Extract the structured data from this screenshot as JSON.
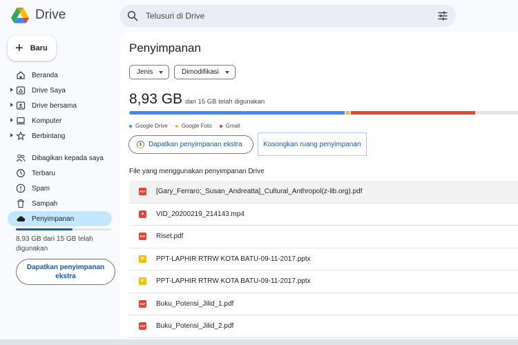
{
  "app": {
    "title": "Drive"
  },
  "search": {
    "placeholder": "Telusuri di Drive"
  },
  "new_button": {
    "label": "Baru"
  },
  "sidebar": {
    "items": [
      {
        "label": "Beranda",
        "icon": "home-icon",
        "arrow": false
      },
      {
        "label": "Drive Saya",
        "icon": "my-drive-icon",
        "arrow": true
      },
      {
        "label": "Drive bersama",
        "icon": "shared-drive-icon",
        "arrow": true
      },
      {
        "label": "Komputer",
        "icon": "computer-icon",
        "arrow": true
      },
      {
        "label": "Berbintang",
        "icon": "star-icon",
        "arrow": true
      }
    ],
    "items2": [
      {
        "label": "Dibagikan kepada saya",
        "icon": "people-icon"
      },
      {
        "label": "Terbaru",
        "icon": "clock-icon"
      },
      {
        "label": "Spam",
        "icon": "spam-icon"
      },
      {
        "label": "Sampah",
        "icon": "trash-icon"
      },
      {
        "label": "Penyimpanan",
        "icon": "cloud-icon",
        "active": true
      }
    ],
    "storage_text": "8,93 GB dari 15 GB telah digunakan",
    "storage_fraction": 0.595,
    "get_storage_label": "Dapatkan penyimpanan ekstra"
  },
  "main": {
    "title": "Penyimpanan",
    "filters": [
      "Jenis",
      "Dimodifikasi"
    ],
    "used_amount": "8,93 GB",
    "used_of": "dari 15 GB telah digunakan",
    "usage_segments": [
      {
        "name": "Google Drive",
        "color": "#4285f4",
        "fraction": 0.541
      },
      {
        "name": "Google Foto",
        "color": "#fbbc04",
        "fraction": 0.01
      },
      {
        "name": "Gmail",
        "color": "#ea4335",
        "fraction": 0.312
      }
    ],
    "get_storage_label": "Dapatkan penyimpanan ekstra",
    "clean_label": "Kosongkan ruang penyimpanan",
    "files_heading": "File yang menggunakan penyimpanan Drive",
    "files": [
      {
        "name": "[Gary_Ferraro;_Susan_Andreatta]_Cultural_Anthropol(z-lib.org).pdf",
        "type": "pdf"
      },
      {
        "name": "VID_20200219_214143.mp4",
        "type": "video"
      },
      {
        "name": "Riset.pdf",
        "type": "pdf"
      },
      {
        "name": "PPT-LAPHIR RTRW KOTA BATU-09-11-2017.pptx",
        "type": "pptx"
      },
      {
        "name": "PPT-LAPHIR RTRW KOTA BATU-09-11-2017.pptx",
        "type": "pptx"
      },
      {
        "name": "Buku_Potensi_Jilid_1.pdf",
        "type": "pdf"
      },
      {
        "name": "Buku_Potensi_Jilid_2.pdf",
        "type": "pdf"
      }
    ]
  }
}
